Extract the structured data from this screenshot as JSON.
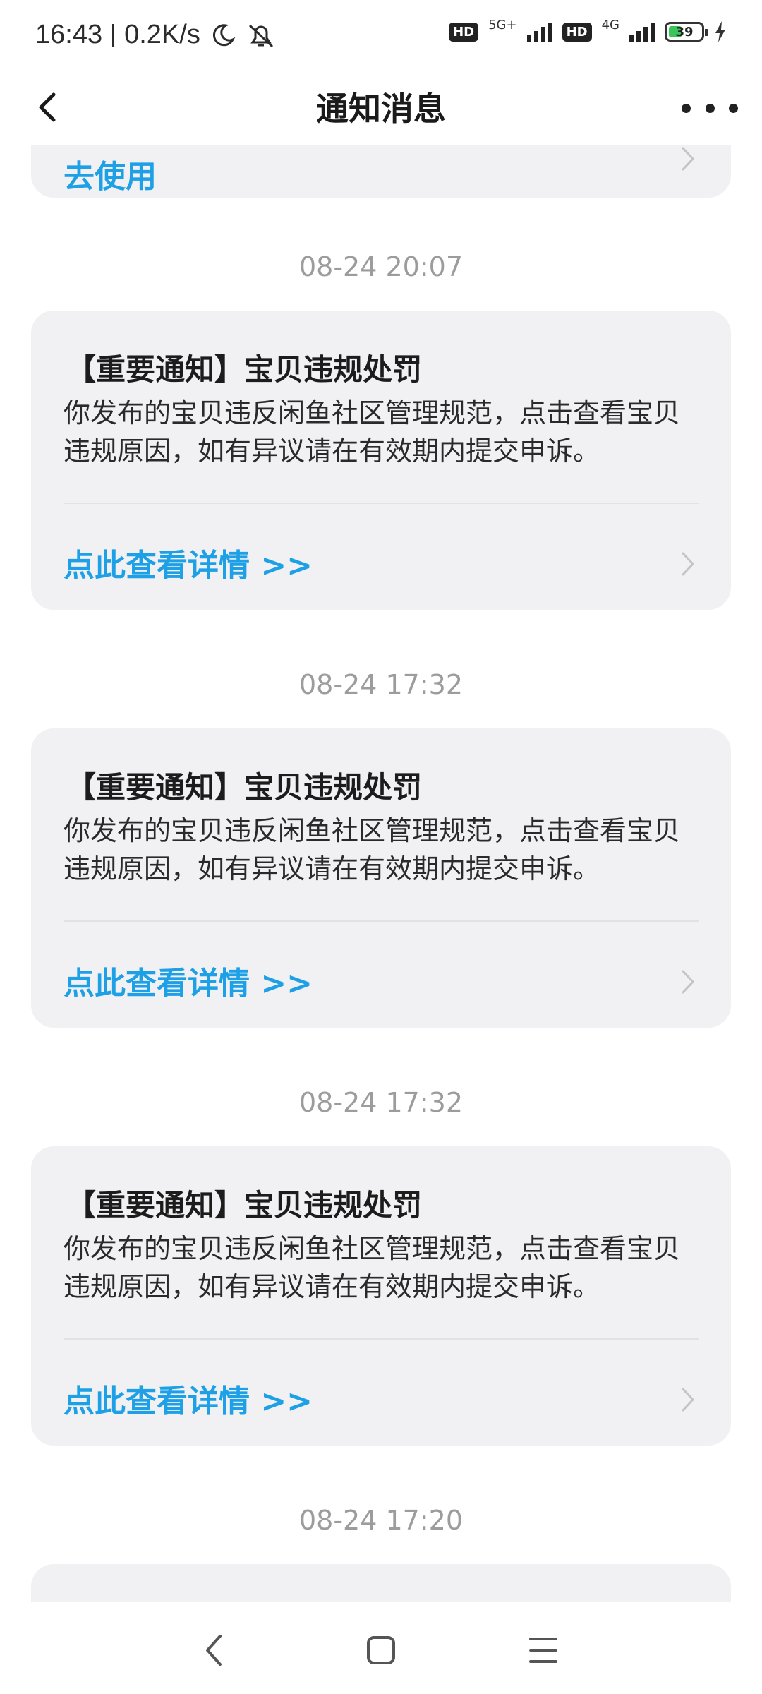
{
  "status_bar": {
    "time": "16:43",
    "speed": "0.2K/s",
    "hd1": "HD",
    "net1": "5G+",
    "hd2": "HD",
    "net2": "4G",
    "battery": "39"
  },
  "header": {
    "title": "通知消息"
  },
  "top_partial": {
    "text": "去使用"
  },
  "notifications": [
    {
      "time": "08-24 20:07",
      "title": "【重要通知】宝贝违规处罚",
      "body": "你发布的宝贝违反闲鱼社区管理规范，点击查看宝贝违规原因，如有异议请在有效期内提交申诉。",
      "link": "点此查看详情 >>"
    },
    {
      "time": "08-24 17:32",
      "title": "【重要通知】宝贝违规处罚",
      "body": "你发布的宝贝违反闲鱼社区管理规范，点击查看宝贝违规原因，如有异议请在有效期内提交申诉。",
      "link": "点此查看详情 >>"
    },
    {
      "time": "08-24 17:32",
      "title": "【重要通知】宝贝违规处罚",
      "body": "你发布的宝贝违反闲鱼社区管理规范，点击查看宝贝违规原因，如有异议请在有效期内提交申诉。",
      "link": "点此查看详情 >>"
    },
    {
      "time": "08-24 17:20"
    }
  ],
  "colors": {
    "link": "#1ea0e6",
    "card_bg": "#f1f1f3",
    "timestamp": "#9c9c9c"
  }
}
